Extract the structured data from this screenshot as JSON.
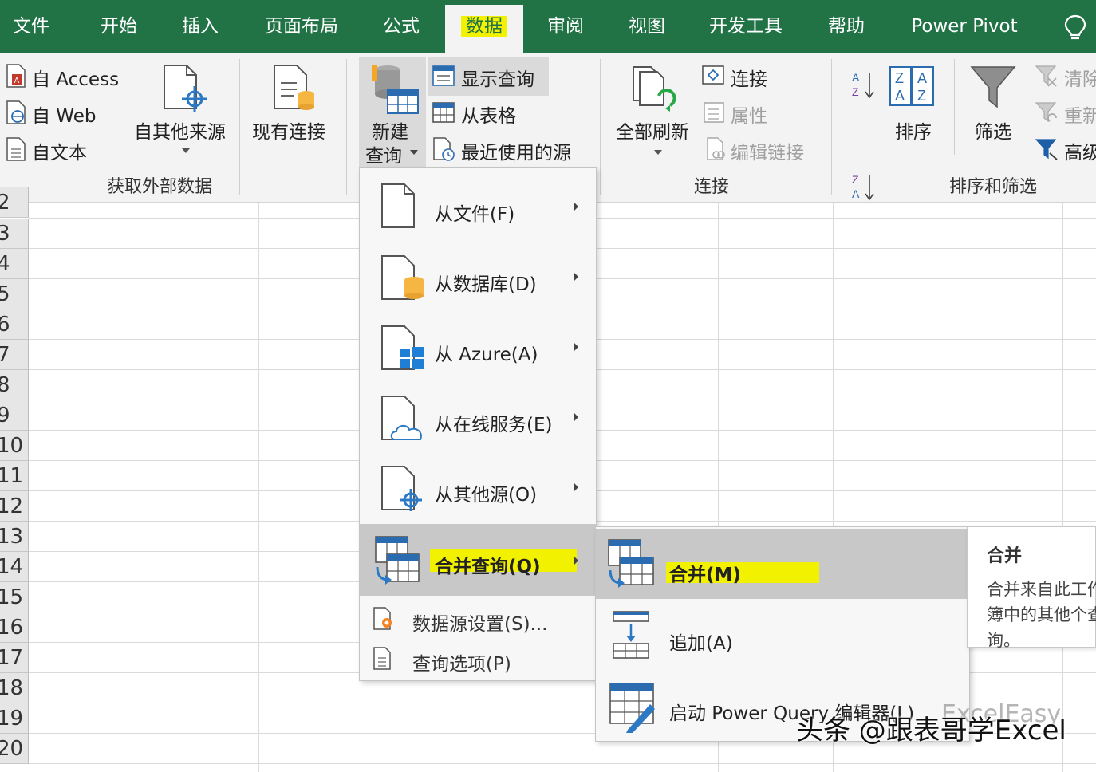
{
  "tabs": [
    "文件",
    "开始",
    "插入",
    "页面布局",
    "公式",
    "数据",
    "审阅",
    "视图",
    "开发工具",
    "帮助",
    "Power Pivot"
  ],
  "active_tab": "数据",
  "colors": {
    "accent": "#217346",
    "highlight": "#f2f200",
    "menu_hover": "#c8c8c8"
  },
  "ribbon": {
    "external": {
      "access": "自 Access",
      "web": "自 Web",
      "text": "自文本",
      "other_line1": "自其他来源",
      "existing": "现有连接",
      "group_label": "获取外部数据"
    },
    "query": {
      "new_line1": "新建",
      "new_line2": "查询",
      "show_queries": "显示查询",
      "from_table": "从表格",
      "recent_sources": "最近使用的源"
    },
    "connections": {
      "refresh_all": "全部刷新",
      "connections": "连接",
      "properties": "属性",
      "edit_links": "编辑链接",
      "group_label": "连接"
    },
    "sort_filter": {
      "sort": "排序",
      "filter": "筛选",
      "clear": "清除",
      "reapply": "重新",
      "advanced": "高级",
      "group_label": "排序和筛选"
    }
  },
  "row_numbers": [
    "2",
    "3",
    "4",
    "5",
    "6",
    "7",
    "8",
    "9",
    "10",
    "11",
    "12",
    "13",
    "14",
    "15",
    "16",
    "17",
    "18",
    "19",
    "20"
  ],
  "new_query_menu": {
    "items": [
      {
        "label": "从文件(F)"
      },
      {
        "label": "从数据库(D)"
      },
      {
        "label": "从 Azure(A)"
      },
      {
        "label": "从在线服务(E)"
      },
      {
        "label": "从其他源(O)"
      },
      {
        "label": "合并查询(Q)"
      }
    ],
    "data_source_settings": "数据源设置(S)...",
    "query_options": "查询选项(P)"
  },
  "combine_menu": {
    "merge": "合并(M)",
    "append": "追加(A)",
    "launch_editor": "启动 Power Query 编辑器(L)"
  },
  "tooltip": {
    "title": "合并",
    "description": "合并来自此工作簿中的其他个查询。"
  },
  "watermark": {
    "text": "头条 @跟表哥学Excel",
    "faint": "ExcelEasy"
  }
}
